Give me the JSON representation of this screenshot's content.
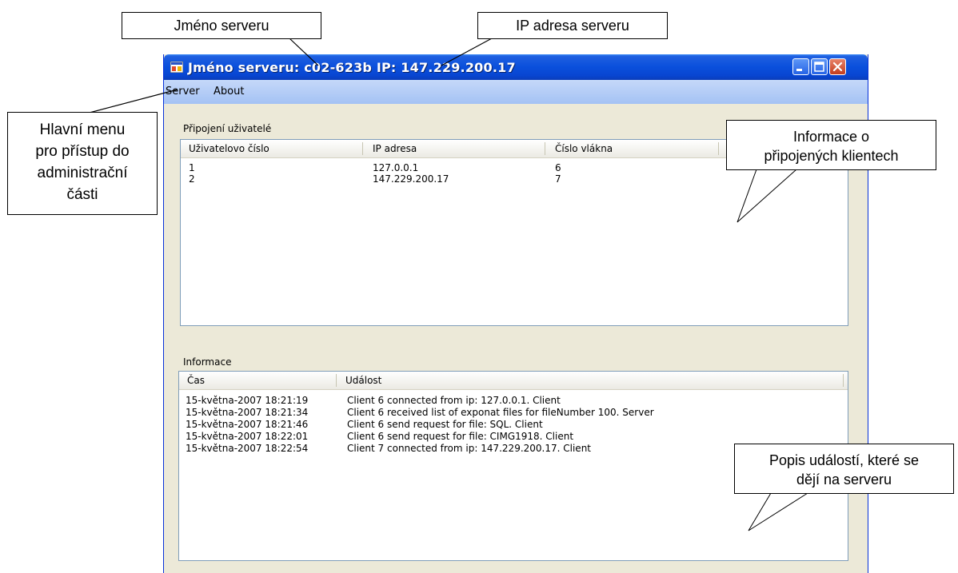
{
  "window": {
    "title": "Jméno serveru: c02-623b IP: 147.229.200.17"
  },
  "menu": {
    "items": [
      "Server",
      "About"
    ]
  },
  "connected": {
    "label": "Připojení uživatelé",
    "columns": [
      "Uživatelovo číslo",
      "IP adresa",
      "Číslo vlákna"
    ],
    "rows": [
      [
        "1",
        "127.0.0.1",
        "6"
      ],
      [
        "2",
        "147.229.200.17",
        "7"
      ]
    ]
  },
  "info": {
    "label": "Informace",
    "columns": [
      "Čas",
      "Událost"
    ],
    "rows": [
      [
        "15-května-2007  18:21:19",
        "Client 6 connected from ip: 127.0.0.1. Client"
      ],
      [
        "15-května-2007  18:21:34",
        "Client 6 received list of exponat files for fileNumber 100. Server"
      ],
      [
        "15-května-2007  18:21:46",
        "Client 6 send request for file: SQL. Client"
      ],
      [
        "15-května-2007  18:22:01",
        "Client 6 send request for file: CIMG1918. Client"
      ],
      [
        "15-května-2007  18:22:54",
        "Client 7 connected from ip: 147.229.200.17. Client"
      ]
    ]
  },
  "annotations": {
    "server_name": "Jméno serveru",
    "server_ip": "IP adresa serveru",
    "main_menu": [
      "Hlavní menu",
      "pro přístup do",
      "administrační",
      "části"
    ],
    "clients_info": [
      "Informace o",
      "připojených klientech"
    ],
    "events_info": [
      "Popis událostí, které se",
      "dějí na serveru"
    ]
  }
}
